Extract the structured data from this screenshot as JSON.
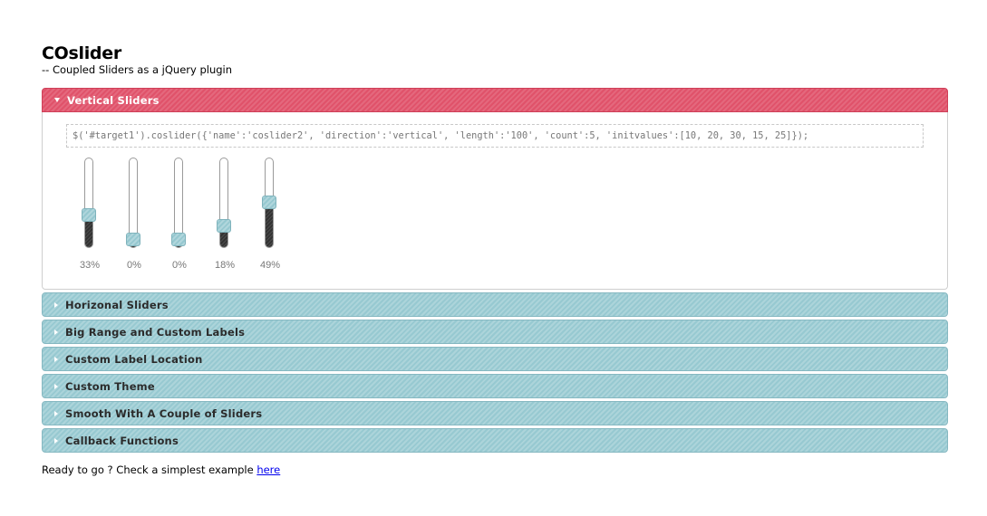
{
  "page": {
    "title": "COslider",
    "subtitle": "-- Coupled Sliders as a jQuery plugin"
  },
  "accordion": {
    "active_section": {
      "title": "Vertical Sliders",
      "code": "$('#target1').coslider({'name':'coslider2', 'direction':'vertical', 'length':'100', 'count':5, 'initvalues':[10, 20, 30, 15, 25]});",
      "sliders": [
        {
          "label": "33%",
          "value": 33
        },
        {
          "label": "0%",
          "value": 0
        },
        {
          "label": "0%",
          "value": 0
        },
        {
          "label": "18%",
          "value": 18
        },
        {
          "label": "49%",
          "value": 49
        }
      ]
    },
    "sections": [
      {
        "title": "Horizonal Sliders"
      },
      {
        "title": "Big Range and Custom Labels"
      },
      {
        "title": "Custom Label Location"
      },
      {
        "title": "Custom Theme"
      },
      {
        "title": "Smooth With A Couple of Sliders"
      },
      {
        "title": "Callback Functions"
      }
    ]
  },
  "footer": {
    "text": "Ready to go ? Check a simplest example ",
    "link": "here"
  },
  "colors": {
    "active_header": "#e0526a",
    "closed_header": "#97c9d1",
    "slider_fill": "#333333",
    "slider_handle": "#96c8d0"
  }
}
